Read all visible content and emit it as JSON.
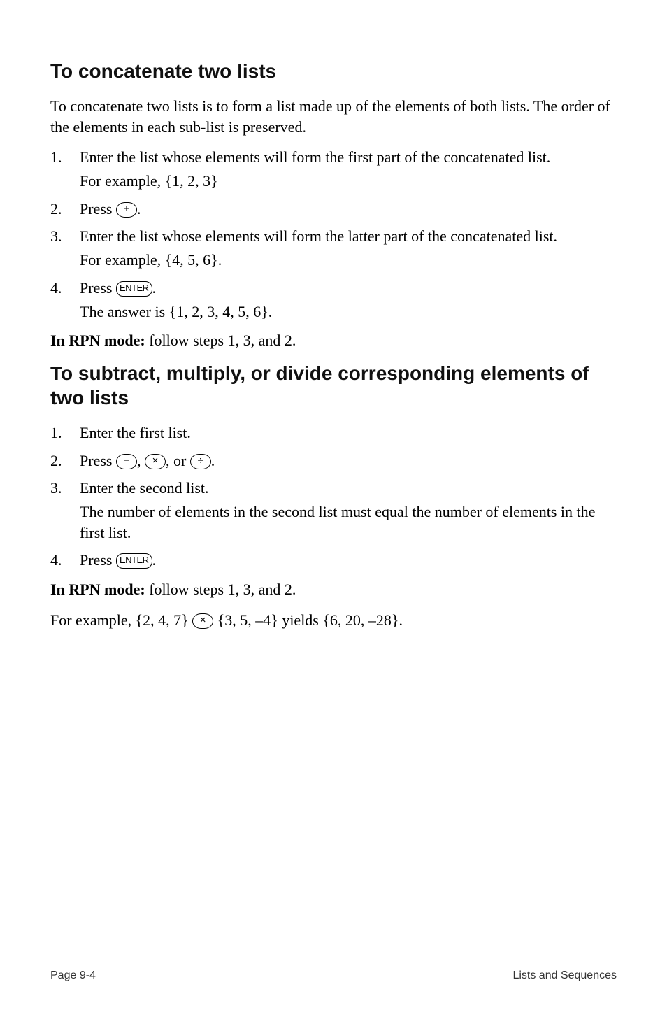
{
  "section1": {
    "heading": "To concatenate two lists",
    "intro": "To concatenate two lists is to form a list made up of the elements of both lists. The order of the elements in each sub-list is preserved.",
    "steps": [
      {
        "num": "1.",
        "text": "Enter the list whose elements will form the first part of the concatenated list.",
        "sub": "For example, {1, 2, 3}"
      },
      {
        "num": "2.",
        "pre": "Press ",
        "key": "+",
        "post": "."
      },
      {
        "num": "3.",
        "text": "Enter the list whose elements will form the latter part of the concatenated list.",
        "sub": "For example, {4, 5, 6}."
      },
      {
        "num": "4.",
        "pre": "Press ",
        "key": "ENTER",
        "post": ".",
        "sub": "The answer is {1, 2, 3, 4, 5, 6}."
      }
    ],
    "rpn_lead": "In RPN mode:",
    "rpn_rest": " follow steps 1, 3, and 2."
  },
  "section2": {
    "heading": "To subtract, multiply, or divide corresponding elements of two lists",
    "steps": [
      {
        "num": "1.",
        "text": "Enter the first list."
      },
      {
        "num": "2.",
        "pre": "Press ",
        "key1": "−",
        "mid1": ", ",
        "key2": "×",
        "mid2": ", or ",
        "key3": "÷",
        "post": "."
      },
      {
        "num": "3.",
        "text": "Enter the second list.",
        "sub": "The number of elements in the second list must equal the number of elements in the first list."
      },
      {
        "num": "4.",
        "pre": "Press ",
        "key": "ENTER",
        "post": "."
      }
    ],
    "rpn_lead": "In RPN mode:",
    "rpn_rest": " follow steps 1, 3, and 2.",
    "example_pre": "For example, {2, 4, 7} ",
    "example_key": "×",
    "example_post": " {3, 5, –4} yields {6, 20, –28}."
  },
  "footer": {
    "left": "Page 9-4",
    "right": "Lists and Sequences"
  }
}
